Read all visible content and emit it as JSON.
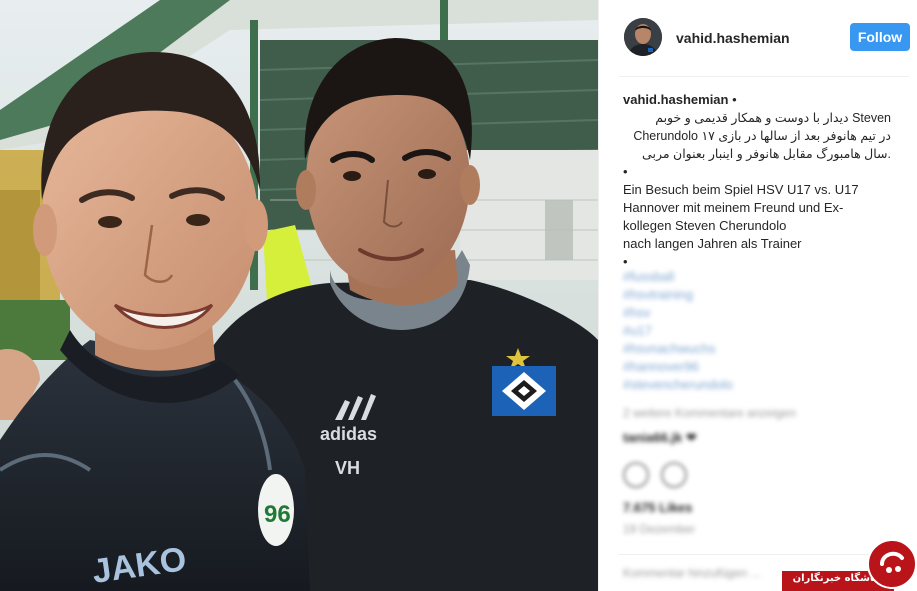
{
  "post": {
    "username": "vahid.hashemian",
    "follow_label": "Follow"
  },
  "caption": {
    "author": "vahid.hashemian",
    "separator": " •",
    "persian_lines": [
      "Steven دیدار با دوست و همکار قدیمی و خوبم",
      "در تیم هانوفر بعد از سالها در بازی ۱۷ Cherundolo",
      ".سال هامبورگ مقابل هانوفر و اینبار بعنوان مربی"
    ],
    "bullet": "•",
    "german_lines": [
      "Ein Besuch beim Spiel HSV U17 vs. U17",
      "Hannover mit meinem Freund und Ex-",
      "kollegen Steven Cherundolo",
      "nach langen Jahren als Trainer"
    ]
  },
  "hashtags": [
    "#fussball",
    "#hsvtraining",
    "#hsv",
    "#u17",
    "#hsvnachwuchs",
    "#hannover96",
    "#stevencherundolo"
  ],
  "blurred": {
    "more_text": "2 weitere Kommentare anzeigen",
    "comment": "tania66.jk ❤",
    "likes": "7.675 Likes",
    "date": "19 Dezember",
    "comment_placeholder": "Kommentar hinzufügen ..."
  },
  "photo": {
    "jersey_left": "JAKO",
    "jersey_right_brand": "adidas",
    "jersey_initials": "VH"
  },
  "watermark": {
    "text": "باشگاه خبرنگاران"
  },
  "colors": {
    "follow_button": "#3897f0",
    "watermark_red": "#b8141a",
    "hashtag_blue": "#7fa7d1"
  }
}
